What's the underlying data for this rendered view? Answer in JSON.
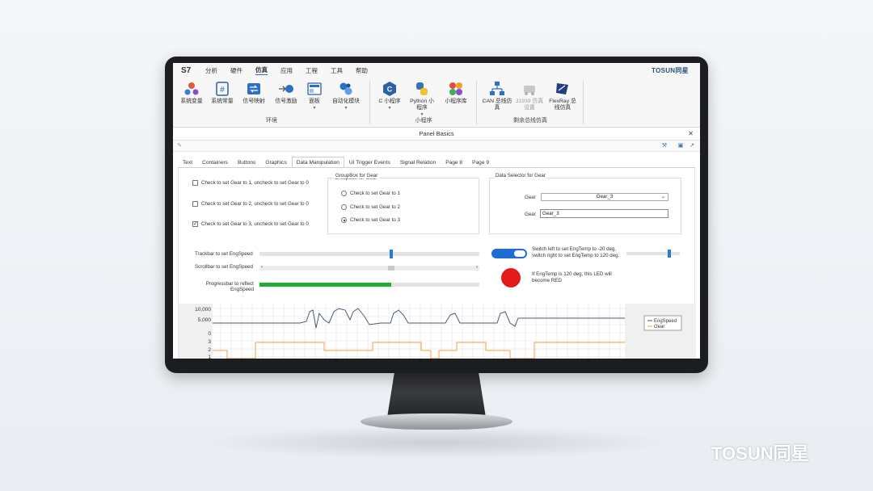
{
  "menubar": {
    "logo": "S7",
    "items": [
      "分析",
      "硬件",
      "仿真",
      "应用",
      "工程",
      "工具",
      "帮助"
    ],
    "active_index": 2,
    "brand": "TOSUN同星"
  },
  "ribbon": {
    "groups": [
      {
        "label": "环境",
        "tools": [
          {
            "label": "系统变量",
            "icon": "system-variables-icon"
          },
          {
            "label": "系统常量",
            "icon": "system-constants-icon"
          },
          {
            "label": "信号映射",
            "icon": "signal-mapping-icon"
          },
          {
            "label": "信号激励",
            "icon": "signal-stimulus-icon"
          },
          {
            "label": "面板",
            "icon": "panel-icon"
          },
          {
            "label": "自动化模块",
            "icon": "automation-module-icon"
          }
        ]
      },
      {
        "label": "小程序",
        "tools": [
          {
            "label": "C 小程序",
            "icon": "c-script-icon"
          },
          {
            "label": "Python 小程序",
            "icon": "python-icon"
          },
          {
            "label": "小程序库",
            "icon": "script-library-icon"
          }
        ]
      },
      {
        "label": "剩余总线仿真",
        "tools": [
          {
            "label": "CAN 总线仿真",
            "icon": "can-bus-icon"
          },
          {
            "label": "J1939 仿真设置",
            "icon": "j1939-icon"
          },
          {
            "label": "FlexRay 总线仿真",
            "icon": "flexray-icon"
          }
        ]
      }
    ]
  },
  "panel": {
    "title": "Panel Basics",
    "tabs": [
      "Text",
      "Containers",
      "Buttons",
      "Graphics",
      "Data Manipulation",
      "UI Trigger Events",
      "Signal Relation",
      "Page 8",
      "Page 9"
    ],
    "active_tab": 4,
    "checkboxes": [
      {
        "label": "Check to set Gear to 1, uncheck to set Gear to 0",
        "checked": false
      },
      {
        "label": "Check to set Gear to 2, uncheck to set Gear to 0",
        "checked": false
      },
      {
        "label": "Check to set Gear to 3, uncheck to set Gear to 0",
        "checked": true
      }
    ],
    "groupbox": {
      "title": "GroupBox for Gear",
      "radios": [
        {
          "label": "Check to set Gear to 1",
          "selected": false
        },
        {
          "label": "Check to set Gear to 2",
          "selected": false
        },
        {
          "label": "Check to set Gear to 3",
          "selected": true
        }
      ]
    },
    "data_selector": {
      "title": "Data Selector for Gear",
      "gear_label": "Gear",
      "select_value": "Gear_3",
      "text_value": "Gear_3"
    },
    "trackbar": {
      "label": "Trackbar to set EngSpeed",
      "value": 0.6
    },
    "scrollbar": {
      "label": "Scrollbar to set EngSpeed",
      "value": 0.6
    },
    "progressbar": {
      "label_line1": "Progressbar to reflect",
      "label_line2": "EngSpeed",
      "value": 0.6
    },
    "switch": {
      "text_line1": "Switch left to set EngTemp to -20 deg,",
      "text_line2": "switch right to set EngTemp to 120 deg.",
      "on": true,
      "slider_value": 0.8
    },
    "led": {
      "text_line1": "If EngTemp is 120 deg, this LED will",
      "text_line2": "become RED",
      "color": "#e31b1b"
    }
  },
  "chart_data": {
    "type": "line",
    "y_ticks_upper": [
      "10,000",
      "5,000",
      "0"
    ],
    "y_ticks_lower": [
      "3",
      "2",
      "1"
    ],
    "series": [
      {
        "name": "EngSpeed",
        "color": "#4a5a7a"
      },
      {
        "name": "Gear",
        "color": "#f0a04b"
      }
    ],
    "legend": "right",
    "grid": true
  }
}
